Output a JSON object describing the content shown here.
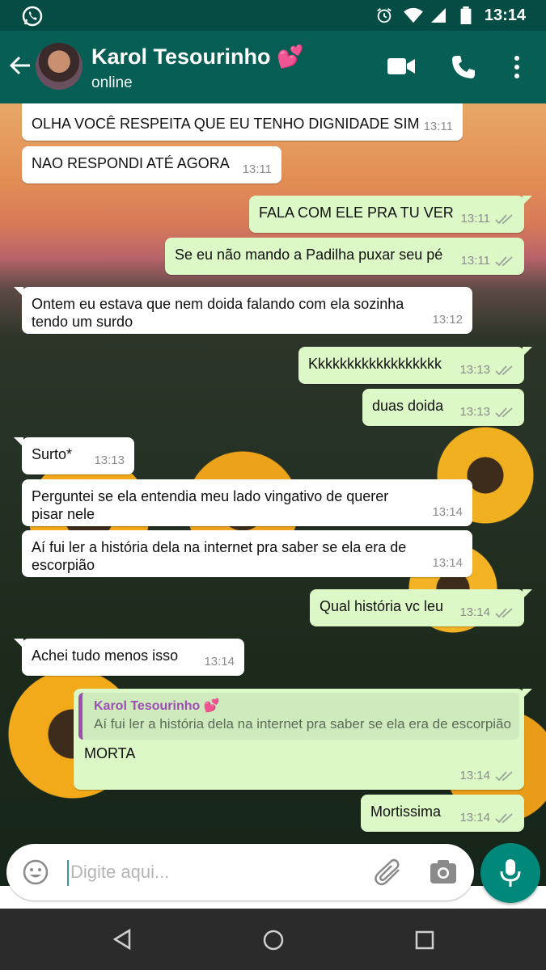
{
  "status_bar": {
    "time": "13:14"
  },
  "header": {
    "contact_name": "Karol Tesourinho 💕",
    "status": "online"
  },
  "messages": [
    {
      "dir": "in",
      "text": "OLHA VOCÊ RESPEITA QUE EU TENHO DIGNIDADE SIM",
      "time": "13:11"
    },
    {
      "dir": "in",
      "text": "NAO RESPONDI ATÉ AGORA",
      "time": "13:11"
    },
    {
      "dir": "out",
      "text": "FALA COM ELE PRA TU VER",
      "time": "13:11"
    },
    {
      "dir": "out",
      "text": "Se eu não mando a Padilha puxar seu pé",
      "time": "13:11"
    },
    {
      "dir": "in",
      "text": "Ontem eu estava que nem doida falando com ela sozinha tendo um surdo",
      "time": "13:12"
    },
    {
      "dir": "out",
      "text": "Kkkkkkkkkkkkkkkkkk",
      "time": "13:13"
    },
    {
      "dir": "out",
      "text": "duas doida",
      "time": "13:13"
    },
    {
      "dir": "in",
      "text": "Surto*",
      "time": "13:13"
    },
    {
      "dir": "in",
      "text": "Perguntei se ela entendia meu lado vingativo de querer pisar nele",
      "time": "13:14"
    },
    {
      "dir": "in",
      "text": "Aí fui ler a história dela na internet pra saber se ela era de escorpião",
      "time": "13:14"
    },
    {
      "dir": "out",
      "text": "Qual história vc leu",
      "time": "13:14"
    },
    {
      "dir": "in",
      "text": "Achei tudo menos isso",
      "time": "13:14"
    },
    {
      "dir": "out",
      "text": "MORTA",
      "time": "13:14",
      "quote": {
        "name": "Karol Tesourinho 💕",
        "text": "Aí fui ler a história dela na internet pra saber se ela era de escorpião"
      }
    },
    {
      "dir": "out",
      "text": "Mortissima",
      "time": "13:14"
    }
  ],
  "composer": {
    "placeholder": "Digite aqui..."
  },
  "colors": {
    "header": "#075e54",
    "statusbar": "#054d44",
    "outgoing": "#dcf8c6",
    "incoming": "#ffffff",
    "accent": "#00897b"
  },
  "icons": [
    "whatsapp-icon",
    "alarm-icon",
    "wifi-icon",
    "signal-icon",
    "battery-icon",
    "back-arrow-icon",
    "video-call-icon",
    "phone-icon",
    "more-vert-icon",
    "emoji-icon",
    "attach-icon",
    "camera-icon",
    "mic-icon",
    "nav-back-icon",
    "nav-home-icon",
    "nav-recents-icon"
  ]
}
